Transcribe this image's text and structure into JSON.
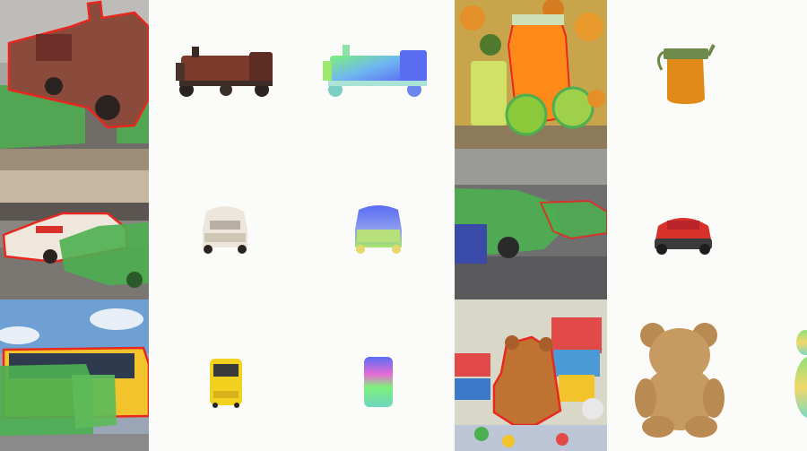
{
  "grid": {
    "rows": [
      {
        "left_scene": "train-scene",
        "left_object": "train",
        "right_scene": "juice-scene",
        "right_object": "juice-jug"
      },
      {
        "left_scene": "cars-scene",
        "left_object": "vintage-car",
        "right_scene": "sportscar-scene",
        "right_object": "sports-car"
      },
      {
        "left_scene": "bus-scene",
        "left_object": "bus",
        "right_scene": "toys-scene",
        "right_object": "teddy-bear"
      }
    ]
  },
  "colors": {
    "background": "#fbfbf9",
    "mask_green": "#4caf50",
    "outline_red": "#e8281e",
    "normal_blue": "#5a6cf2",
    "normal_green": "#7ef07a",
    "normal_pink": "#e86bd6"
  }
}
